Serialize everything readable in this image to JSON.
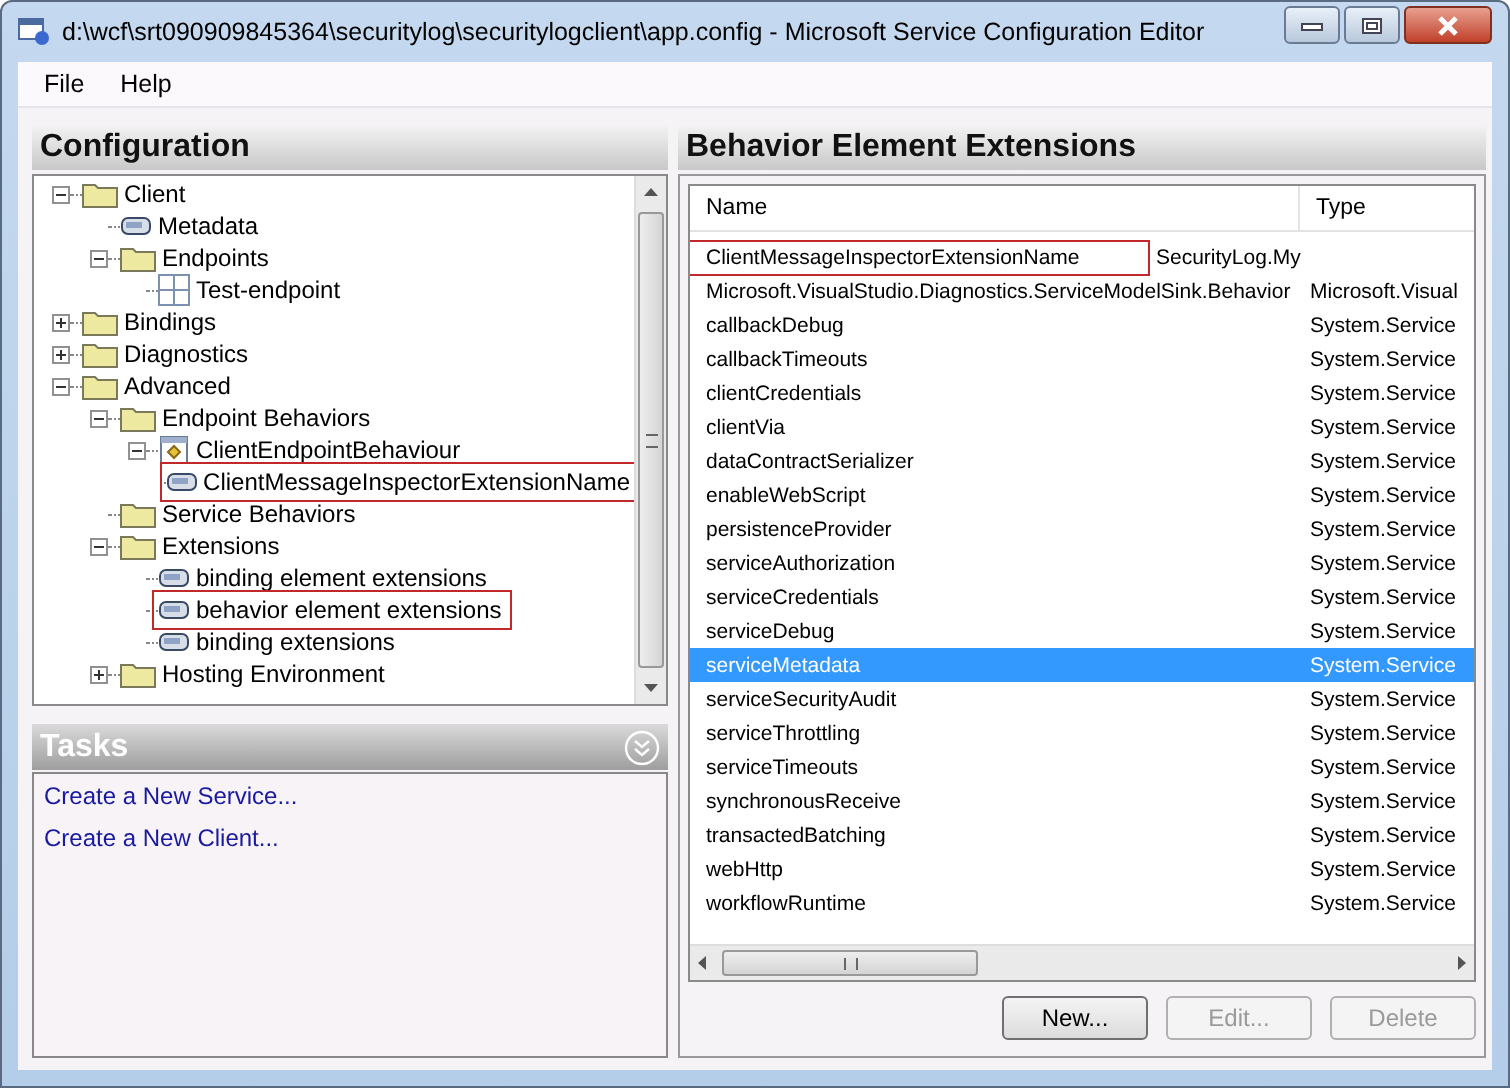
{
  "window": {
    "title": "d:\\wcf\\srt090909845364\\securitylog\\securitylogclient\\app.config - Microsoft Service Configuration Editor"
  },
  "menu": [
    "File",
    "Help"
  ],
  "configuration": {
    "title": "Configuration",
    "tree": [
      {
        "label": "Client",
        "kind": "folder",
        "expanded": true,
        "highlighted": false,
        "children": [
          {
            "label": "Metadata",
            "kind": "node",
            "highlighted": false
          },
          {
            "label": "Endpoints",
            "kind": "folder",
            "expanded": true,
            "highlighted": false,
            "children": [
              {
                "label": "Test-endpoint",
                "kind": "endpoint",
                "highlighted": false
              }
            ]
          }
        ]
      },
      {
        "label": "Bindings",
        "kind": "folder",
        "expanded": false,
        "highlighted": false
      },
      {
        "label": "Diagnostics",
        "kind": "folder",
        "expanded": false,
        "highlighted": false
      },
      {
        "label": "Advanced",
        "kind": "folder",
        "expanded": true,
        "highlighted": false,
        "children": [
          {
            "label": "Endpoint Behaviors",
            "kind": "folder",
            "expanded": true,
            "highlighted": false,
            "children": [
              {
                "label": "ClientEndpointBehaviour",
                "kind": "behavior",
                "expanded": true,
                "highlighted": false,
                "children": [
                  {
                    "label": "ClientMessageInspectorExtensionName",
                    "kind": "node",
                    "highlighted": true
                  }
                ]
              }
            ]
          },
          {
            "label": "Service Behaviors",
            "kind": "folder",
            "highlighted": false
          },
          {
            "label": "Extensions",
            "kind": "folder",
            "expanded": true,
            "highlighted": false,
            "children": [
              {
                "label": "binding element extensions",
                "kind": "node",
                "highlighted": false
              },
              {
                "label": "behavior element extensions",
                "kind": "node",
                "highlighted": true
              },
              {
                "label": "binding extensions",
                "kind": "node",
                "highlighted": false
              }
            ]
          },
          {
            "label": "Hosting Environment",
            "kind": "folder",
            "expanded": false,
            "highlighted": false
          }
        ]
      }
    ]
  },
  "tasks": {
    "title": "Tasks",
    "links": [
      "Create a New Service...",
      "Create a New Client..."
    ]
  },
  "extensions": {
    "title": "Behavior Element Extensions",
    "columns": [
      "Name",
      "Type"
    ],
    "rows": [
      {
        "name": "ClientMessageInspectorExtensionName",
        "type": "SecurityLog.My",
        "selected": false,
        "highlighted": true
      },
      {
        "name": "Microsoft.VisualStudio.Diagnostics.ServiceModelSink.Behavior",
        "type": "Microsoft.Visual",
        "selected": false,
        "highlighted": false
      },
      {
        "name": "callbackDebug",
        "type": "System.Service",
        "selected": false,
        "highlighted": false
      },
      {
        "name": "callbackTimeouts",
        "type": "System.Service",
        "selected": false,
        "highlighted": false
      },
      {
        "name": "clientCredentials",
        "type": "System.Service",
        "selected": false,
        "highlighted": false
      },
      {
        "name": "clientVia",
        "type": "System.Service",
        "selected": false,
        "highlighted": false
      },
      {
        "name": "dataContractSerializer",
        "type": "System.Service",
        "selected": false,
        "highlighted": false
      },
      {
        "name": "enableWebScript",
        "type": "System.Service",
        "selected": false,
        "highlighted": false
      },
      {
        "name": "persistenceProvider",
        "type": "System.Service",
        "selected": false,
        "highlighted": false
      },
      {
        "name": "serviceAuthorization",
        "type": "System.Service",
        "selected": false,
        "highlighted": false
      },
      {
        "name": "serviceCredentials",
        "type": "System.Service",
        "selected": false,
        "highlighted": false
      },
      {
        "name": "serviceDebug",
        "type": "System.Service",
        "selected": false,
        "highlighted": false
      },
      {
        "name": "serviceMetadata",
        "type": "System.Service",
        "selected": true,
        "highlighted": false
      },
      {
        "name": "serviceSecurityAudit",
        "type": "System.Service",
        "selected": false,
        "highlighted": false
      },
      {
        "name": "serviceThrottling",
        "type": "System.Service",
        "selected": false,
        "highlighted": false
      },
      {
        "name": "serviceTimeouts",
        "type": "System.Service",
        "selected": false,
        "highlighted": false
      },
      {
        "name": "synchronousReceive",
        "type": "System.Service",
        "selected": false,
        "highlighted": false
      },
      {
        "name": "transactedBatching",
        "type": "System.Service",
        "selected": false,
        "highlighted": false
      },
      {
        "name": "webHttp",
        "type": "System.Service",
        "selected": false,
        "highlighted": false
      },
      {
        "name": "workflowRuntime",
        "type": "System.Service",
        "selected": false,
        "highlighted": false
      }
    ],
    "buttons": [
      {
        "label": "New...",
        "disabled": false
      },
      {
        "label": "Edit...",
        "disabled": true
      },
      {
        "label": "Delete",
        "disabled": true
      }
    ]
  }
}
